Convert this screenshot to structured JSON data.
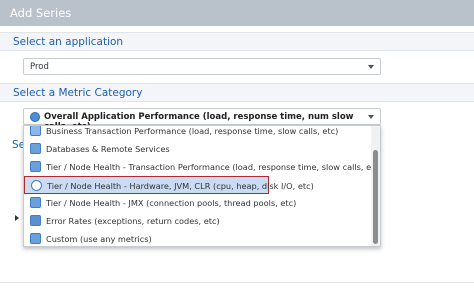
{
  "window": {
    "title": "Add Series"
  },
  "application_section": {
    "heading": "Select an application",
    "selected": "Prod"
  },
  "metric_section": {
    "heading": "Select a Metric Category",
    "selected": "Overall Application Performance (load, response time, num slow calls, etc)"
  },
  "hidden_section": {
    "heading_fragment": "Se"
  },
  "dropdown": {
    "items": [
      {
        "label": "Business Transaction Performance (load, response time, slow calls, etc)",
        "icon": "business-transaction-icon"
      },
      {
        "label": "Databases & Remote Services",
        "icon": "database-icon"
      },
      {
        "label": "Tier / Node Health - Transaction Performance (load, response time, slow calls, etc)",
        "icon": "node-health-icon"
      },
      {
        "label": "Tier / Node Health - Hardware, JVM, CLR (cpu, heap, disk I/O, etc)",
        "icon": "node-hardware-icon"
      },
      {
        "label": "Tier / Node Health - JMX (connection pools, thread pools, etc)",
        "icon": "jmx-icon"
      },
      {
        "label": "Error Rates (exceptions, return codes, etc)",
        "icon": "error-icon"
      },
      {
        "label": "Custom (use any metrics)",
        "icon": "custom-metrics-icon"
      }
    ]
  },
  "colors": {
    "titlebar": "#b9c1cb",
    "heading": "#1d5fb1",
    "selection": "#c9dcf3",
    "highlight_border": "#b02a30"
  }
}
